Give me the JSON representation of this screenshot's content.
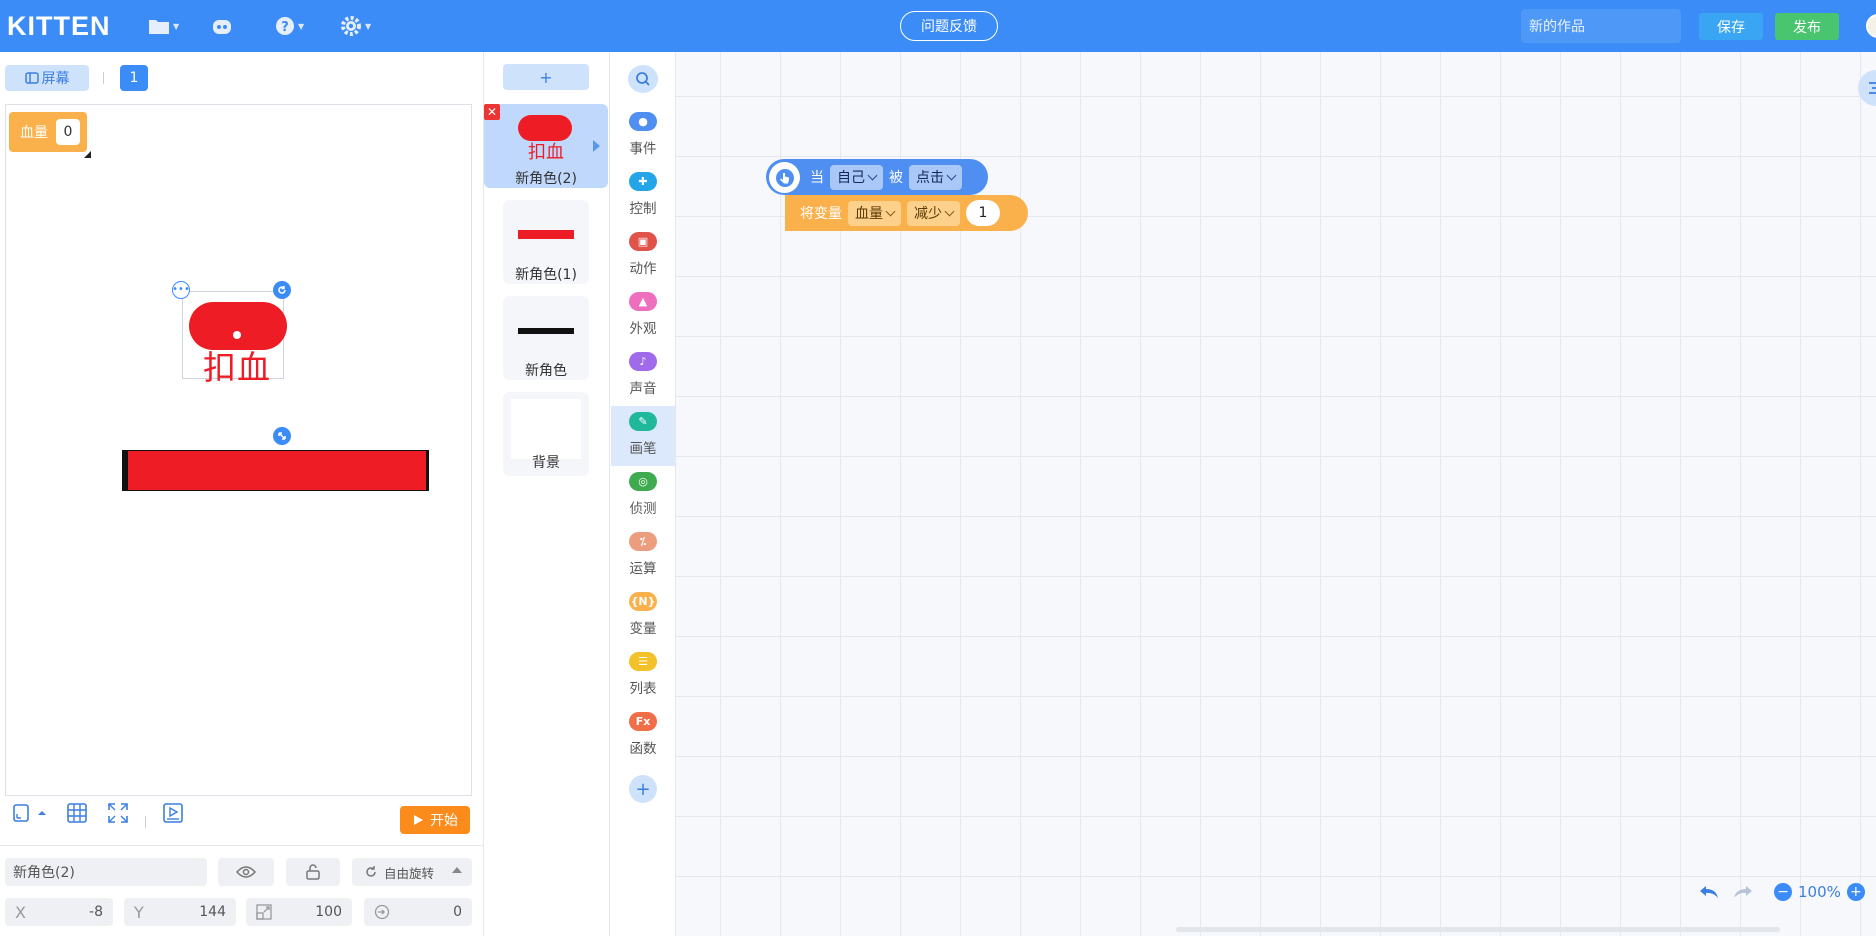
{
  "topbar": {
    "logo": "KITTEN",
    "feedback_label": "问题反馈",
    "project_title_placeholder": "新的作品",
    "save_label": "保存",
    "publish_label": "发布",
    "accent_color": "#3b8cf7"
  },
  "stage": {
    "screen_label": "屏幕",
    "screen_number": "1",
    "variable_monitor": {
      "name": "血量",
      "value": "0"
    },
    "sprite_text": "扣血",
    "start_label": "开始"
  },
  "properties": {
    "sprite_name": "新角色(2)",
    "rotation_mode": "自由旋转",
    "x_label": "X",
    "x_value": "-8",
    "y_label": "Y",
    "y_value": "144",
    "scale_value": "100",
    "rotation_value": "0"
  },
  "sprites": {
    "add_label": "+",
    "items": [
      {
        "name": "新角色(2)",
        "thumb_text": "扣血",
        "active": true
      },
      {
        "name": "新角色(1)",
        "thumb_color": "#ee1c25"
      },
      {
        "name": "新角色",
        "thumb_color": "#111111"
      }
    ],
    "background_label": "背景"
  },
  "categories": [
    {
      "label": "事件",
      "color": "#4e8ff1"
    },
    {
      "label": "控制",
      "color": "#23a5e8"
    },
    {
      "label": "动作",
      "color": "#e0534a"
    },
    {
      "label": "外观",
      "color": "#ef6fbf"
    },
    {
      "label": "声音",
      "color": "#9f6bea"
    },
    {
      "label": "画笔",
      "color": "#1fb89a"
    },
    {
      "label": "侦测",
      "color": "#3faa4f"
    },
    {
      "label": "运算",
      "color": "#ec9d7d"
    },
    {
      "label": "变量",
      "color": "#fbb14b"
    },
    {
      "label": "列表",
      "color": "#f3c12a"
    },
    {
      "label": "函数",
      "color": "#f06f48"
    }
  ],
  "blocks": {
    "event": {
      "when": "当",
      "target": "自己",
      "is": "被",
      "action": "点击"
    },
    "variable": {
      "label": "将变量",
      "var": "血量",
      "op": "减少",
      "amount": "1"
    }
  },
  "workspace": {
    "zoom": "100%"
  }
}
